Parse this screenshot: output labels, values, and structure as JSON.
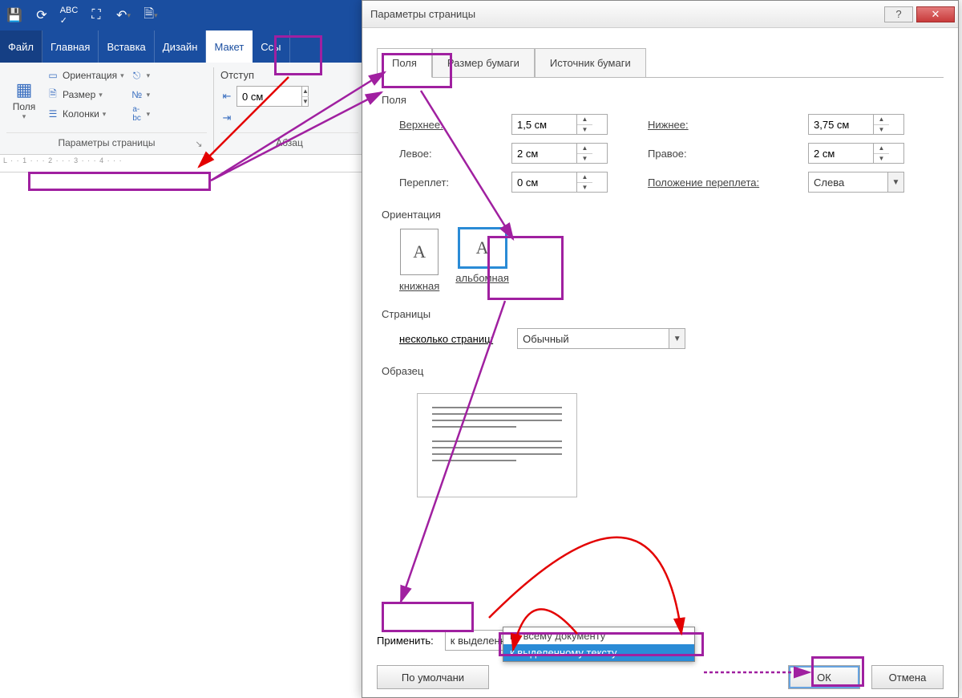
{
  "qat_icons": [
    "save-icon",
    "refresh-icon",
    "spellcheck-icon",
    "maximize-icon",
    "undo-icon",
    "new-doc-icon"
  ],
  "tabs": {
    "file": "Файл",
    "home": "Главная",
    "insert": "Вставка",
    "design": "Дизайн",
    "layout": "Макет",
    "refs": "Ссы"
  },
  "ribbon": {
    "margins": "Поля",
    "orientation": "Ориентация",
    "size": "Размер",
    "columns": "Колонки",
    "indent_label": "Отступ",
    "indent_value": "0 см",
    "group_page_setup": "Параметры страницы",
    "group_paragraph": "Абзац"
  },
  "dialog": {
    "title": "Параметры страницы",
    "tabs": {
      "fields": "Поля",
      "paper": "Размер бумаги",
      "source": "Источник бумаги"
    },
    "section_fields": "Поля",
    "top": "Верхнее:",
    "top_v": "1,5 см",
    "bottom": "Нижнее:",
    "bottom_v": "3,75 см",
    "left": "Левое:",
    "left_v": "2 см",
    "right": "Правое:",
    "right_v": "2 см",
    "gutter": "Переплет:",
    "gutter_v": "0 см",
    "gutter_pos": "Положение переплета:",
    "gutter_pos_v": "Слева",
    "section_orient": "Ориентация",
    "portrait": "книжная",
    "landscape": "альбомная",
    "section_pages": "Страницы",
    "multi_pages": "несколько страниц:",
    "multi_pages_v": "Обычный",
    "section_preview": "Образец",
    "apply": "Применить:",
    "apply_v": "к выделенному тексту",
    "apply_opts": [
      "ко всему документу",
      "к выделенному тексту"
    ],
    "defaults": "По умолчани",
    "ok": "ОК",
    "cancel": "Отмена"
  }
}
